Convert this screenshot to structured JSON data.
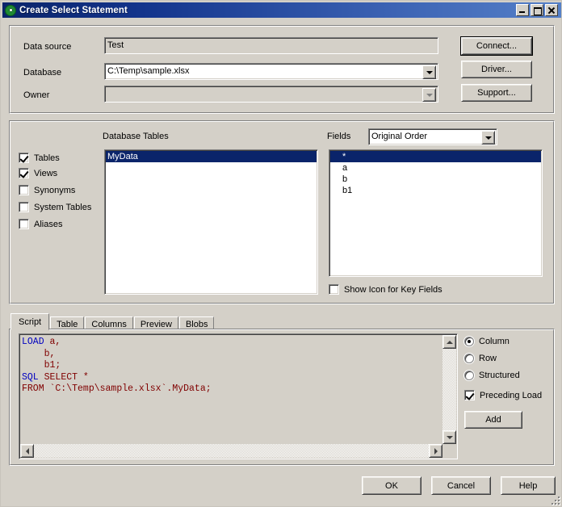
{
  "window": {
    "title": "Create Select Statement",
    "icon": "green-circle-icon",
    "minimize_label": "_",
    "maximize_label": "□",
    "close_label": "×"
  },
  "connection": {
    "data_source_label": "Data source",
    "data_source_value": "Test",
    "database_label": "Database",
    "database_value": "C:\\Temp\\sample.xlsx",
    "owner_label": "Owner",
    "owner_value": "",
    "connect_button": "Connect...",
    "driver_button": "Driver...",
    "support_button": "Support..."
  },
  "filters": {
    "items": [
      {
        "label": "Tables",
        "checked": true
      },
      {
        "label": "Views",
        "checked": true
      },
      {
        "label": "Synonyms",
        "checked": false
      },
      {
        "label": "System Tables",
        "checked": false
      },
      {
        "label": "Aliases",
        "checked": false
      }
    ]
  },
  "tables": {
    "header": "Database Tables",
    "items": [
      {
        "name": "MyData",
        "selected": true
      }
    ]
  },
  "fields": {
    "label": "Fields",
    "order_value": "Original Order",
    "items": [
      {
        "name": "*",
        "selected": true,
        "indent": false
      },
      {
        "name": "a",
        "selected": false,
        "indent": true
      },
      {
        "name": "b",
        "selected": false,
        "indent": true
      },
      {
        "name": "b1",
        "selected": false,
        "indent": true
      }
    ],
    "show_icon_label": "Show Icon for Key Fields",
    "show_icon_checked": false
  },
  "tabs": [
    {
      "label": "Script",
      "active": true
    },
    {
      "label": "Table",
      "active": false
    },
    {
      "label": "Columns",
      "active": false
    },
    {
      "label": "Preview",
      "active": false
    },
    {
      "label": "Blobs",
      "active": false
    }
  ],
  "script": {
    "lines": [
      {
        "keyword": "LOAD",
        "rest": " a,"
      },
      {
        "keyword": "",
        "rest": "    b,"
      },
      {
        "keyword": "",
        "rest": "    b1;"
      },
      {
        "keyword": "SQL",
        "rest": " SELECT *"
      },
      {
        "keyword": "",
        "rest": "FROM `C:\\Temp\\sample.xlsx`.MyData;"
      }
    ],
    "full_text": "LOAD a,\n    b,\n    b1;\nSQL SELECT *\nFROM `C:\\Temp\\sample.xlsx`.MyData;",
    "keyword_color": "#0000c0",
    "text_color": "#800000"
  },
  "script_options": {
    "radios": [
      {
        "label": "Column",
        "selected": true
      },
      {
        "label": "Row",
        "selected": false
      },
      {
        "label": "Structured",
        "selected": false
      }
    ],
    "preceding_load_label": "Preceding Load",
    "preceding_load_checked": true,
    "add_button": "Add"
  },
  "footer": {
    "ok_button": "OK",
    "cancel_button": "Cancel",
    "help_button": "Help"
  },
  "colors": {
    "titlebar_start": "#0a246a",
    "titlebar_end": "#5580c8",
    "selection": "#0a246a",
    "face": "#d4d0c8"
  }
}
